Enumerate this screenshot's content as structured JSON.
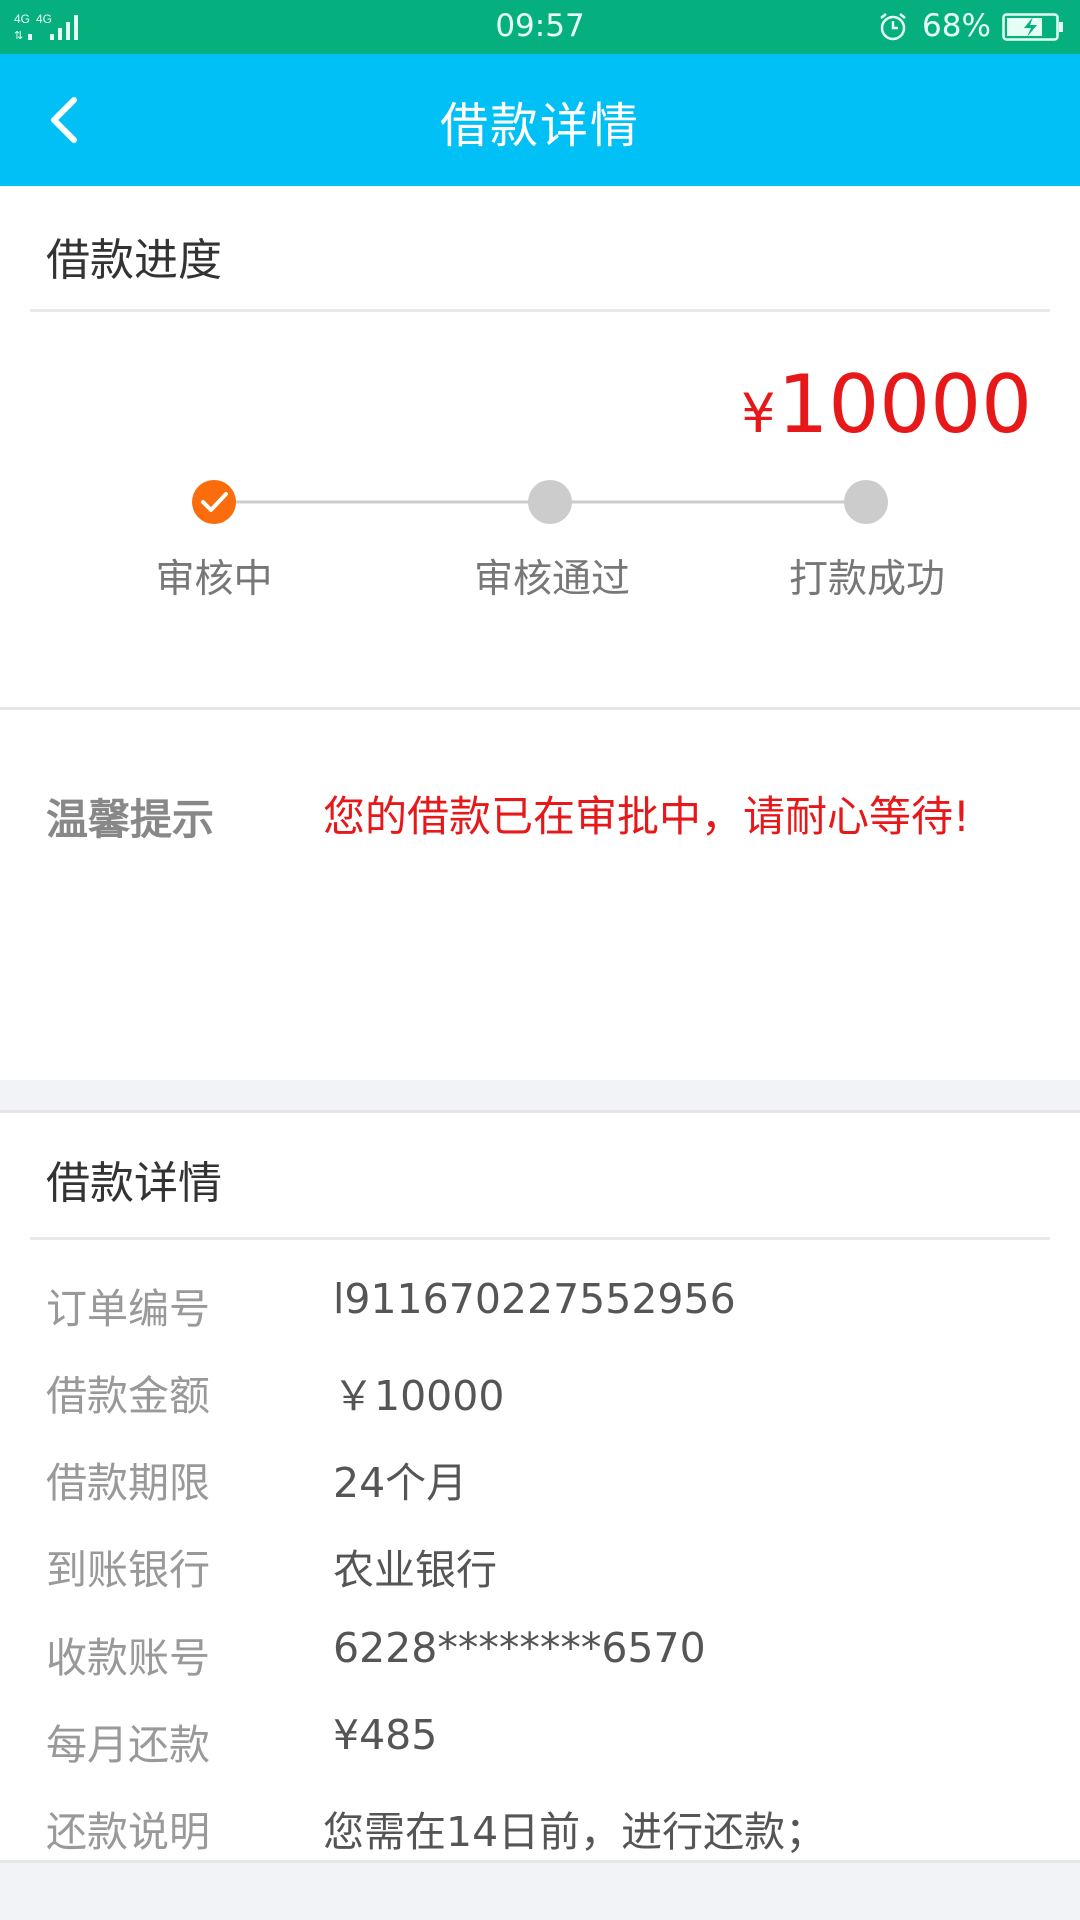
{
  "status_bar": {
    "network": "4G 4G",
    "time": "09:57",
    "battery": "68%"
  },
  "header": {
    "title": "借款详情",
    "back_icon": "chevron-left-icon"
  },
  "progress": {
    "section_title": "借款进度",
    "amount_symbol": "¥",
    "amount": "10000",
    "steps": [
      {
        "label": "审核中",
        "done": true
      },
      {
        "label": "审核通过",
        "done": false
      },
      {
        "label": "打款成功",
        "done": false
      }
    ],
    "active_color": "#fb6d0c",
    "inactive_color": "#cccccc"
  },
  "tip": {
    "label": "温馨提示",
    "text": "您的借款已在审批中，请耐心等待!"
  },
  "details": {
    "section_title": "借款详情",
    "rows": [
      {
        "label": "订单编号",
        "value": "l911670227552956"
      },
      {
        "label": "借款金额",
        "value": "￥10000"
      },
      {
        "label": "借款期限",
        "value": "24个月"
      },
      {
        "label": "到账银行",
        "value": "农业银行"
      },
      {
        "label": "收款账号",
        "value": "6228********6570"
      },
      {
        "label": "每月还款",
        "value": "¥485"
      },
      {
        "label": "还款说明",
        "value": "您需在14日前，进行还款；"
      }
    ]
  },
  "colors": {
    "status_bar": "#06b07e",
    "header": "#00c0f5",
    "accent_red": "#e7181a"
  }
}
